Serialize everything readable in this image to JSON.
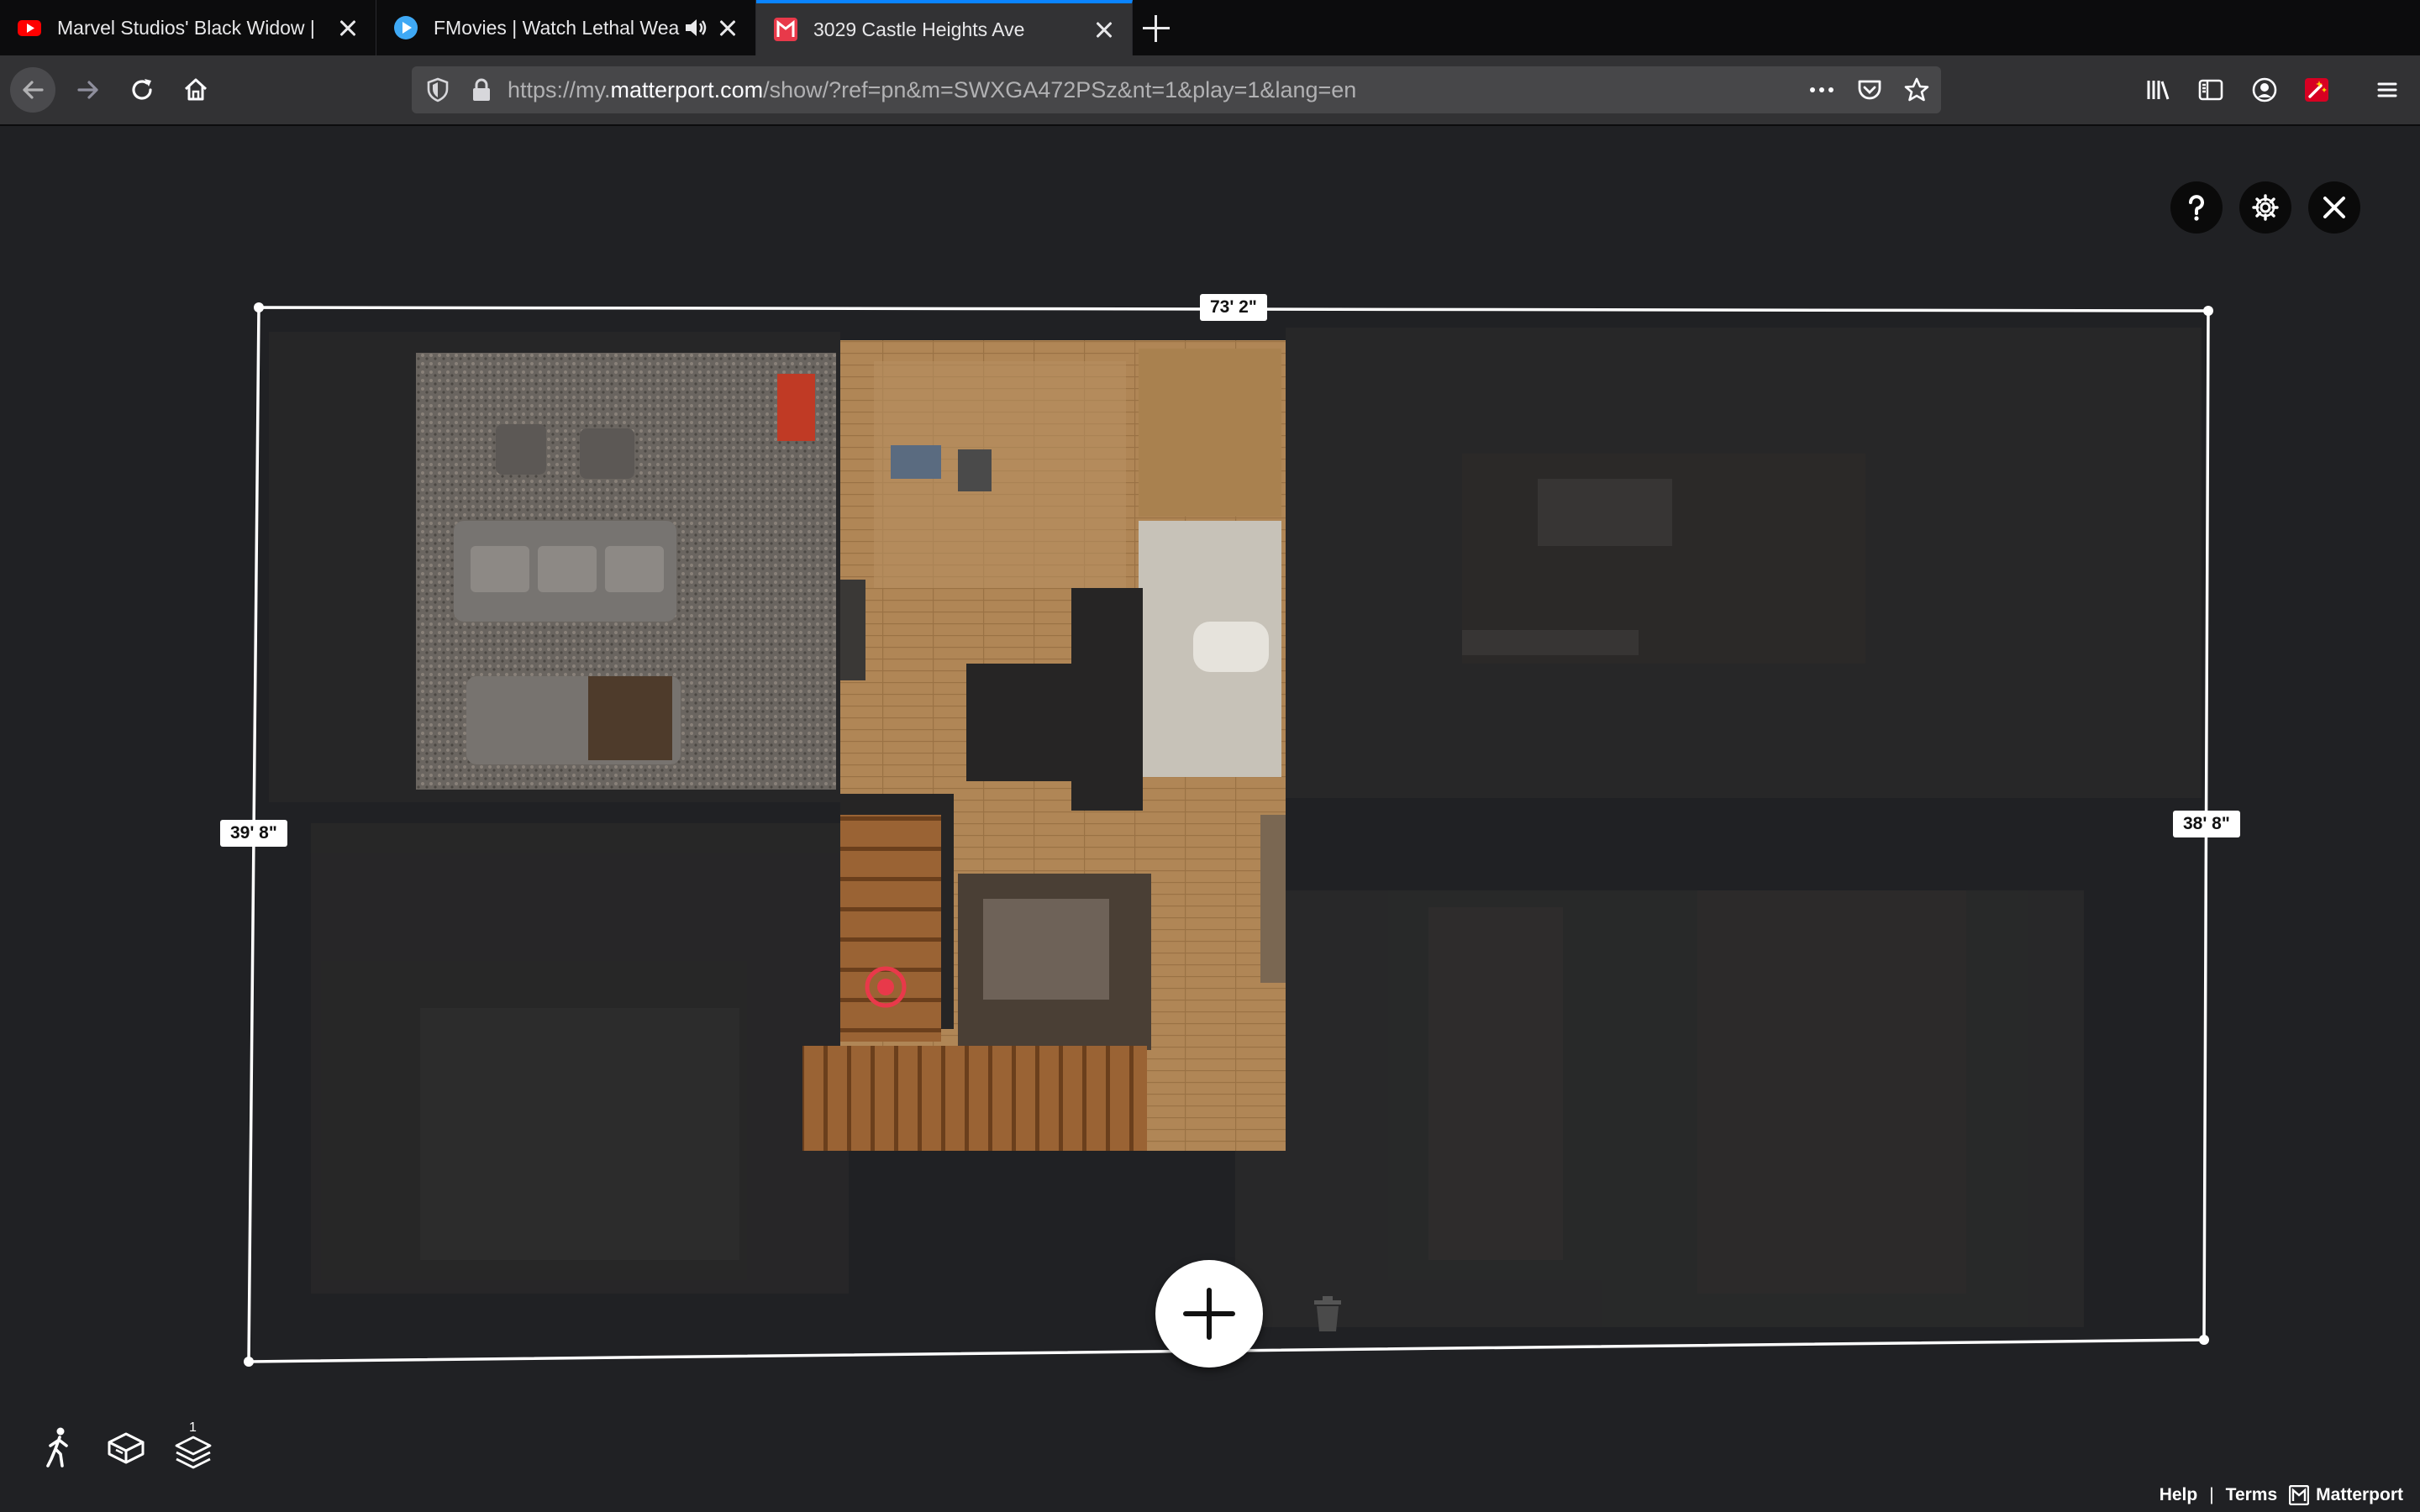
{
  "browser": {
    "tabs": [
      {
        "title": "Marvel Studios' Black Widow | ",
        "favicon": "youtube-icon",
        "color": "#ff0000"
      },
      {
        "title": "FMovies | Watch Lethal Wea",
        "favicon": "play-circle-icon",
        "color": "#3fa9f5",
        "audio": true
      },
      {
        "title": "3029 Castle Heights Ave",
        "favicon": "matterport-icon",
        "color": "#e8394a",
        "active": true
      }
    ],
    "url": {
      "prefix": "https://my.",
      "domain": "matterport.com",
      "path": "/show/?ref=pn&m=SWXGA472PSz&nt=1&play=1&lang=en"
    }
  },
  "viewer": {
    "dimensions": {
      "top": "73' 2\"",
      "left": "39' 8\"",
      "right": "38' 8\""
    },
    "footer": {
      "help": "Help",
      "separator": "|",
      "terms": "Terms",
      "brand": "Matterport"
    },
    "floor_badge": "1",
    "colors": {
      "accent": "#e8394a",
      "background": "#202124"
    }
  }
}
